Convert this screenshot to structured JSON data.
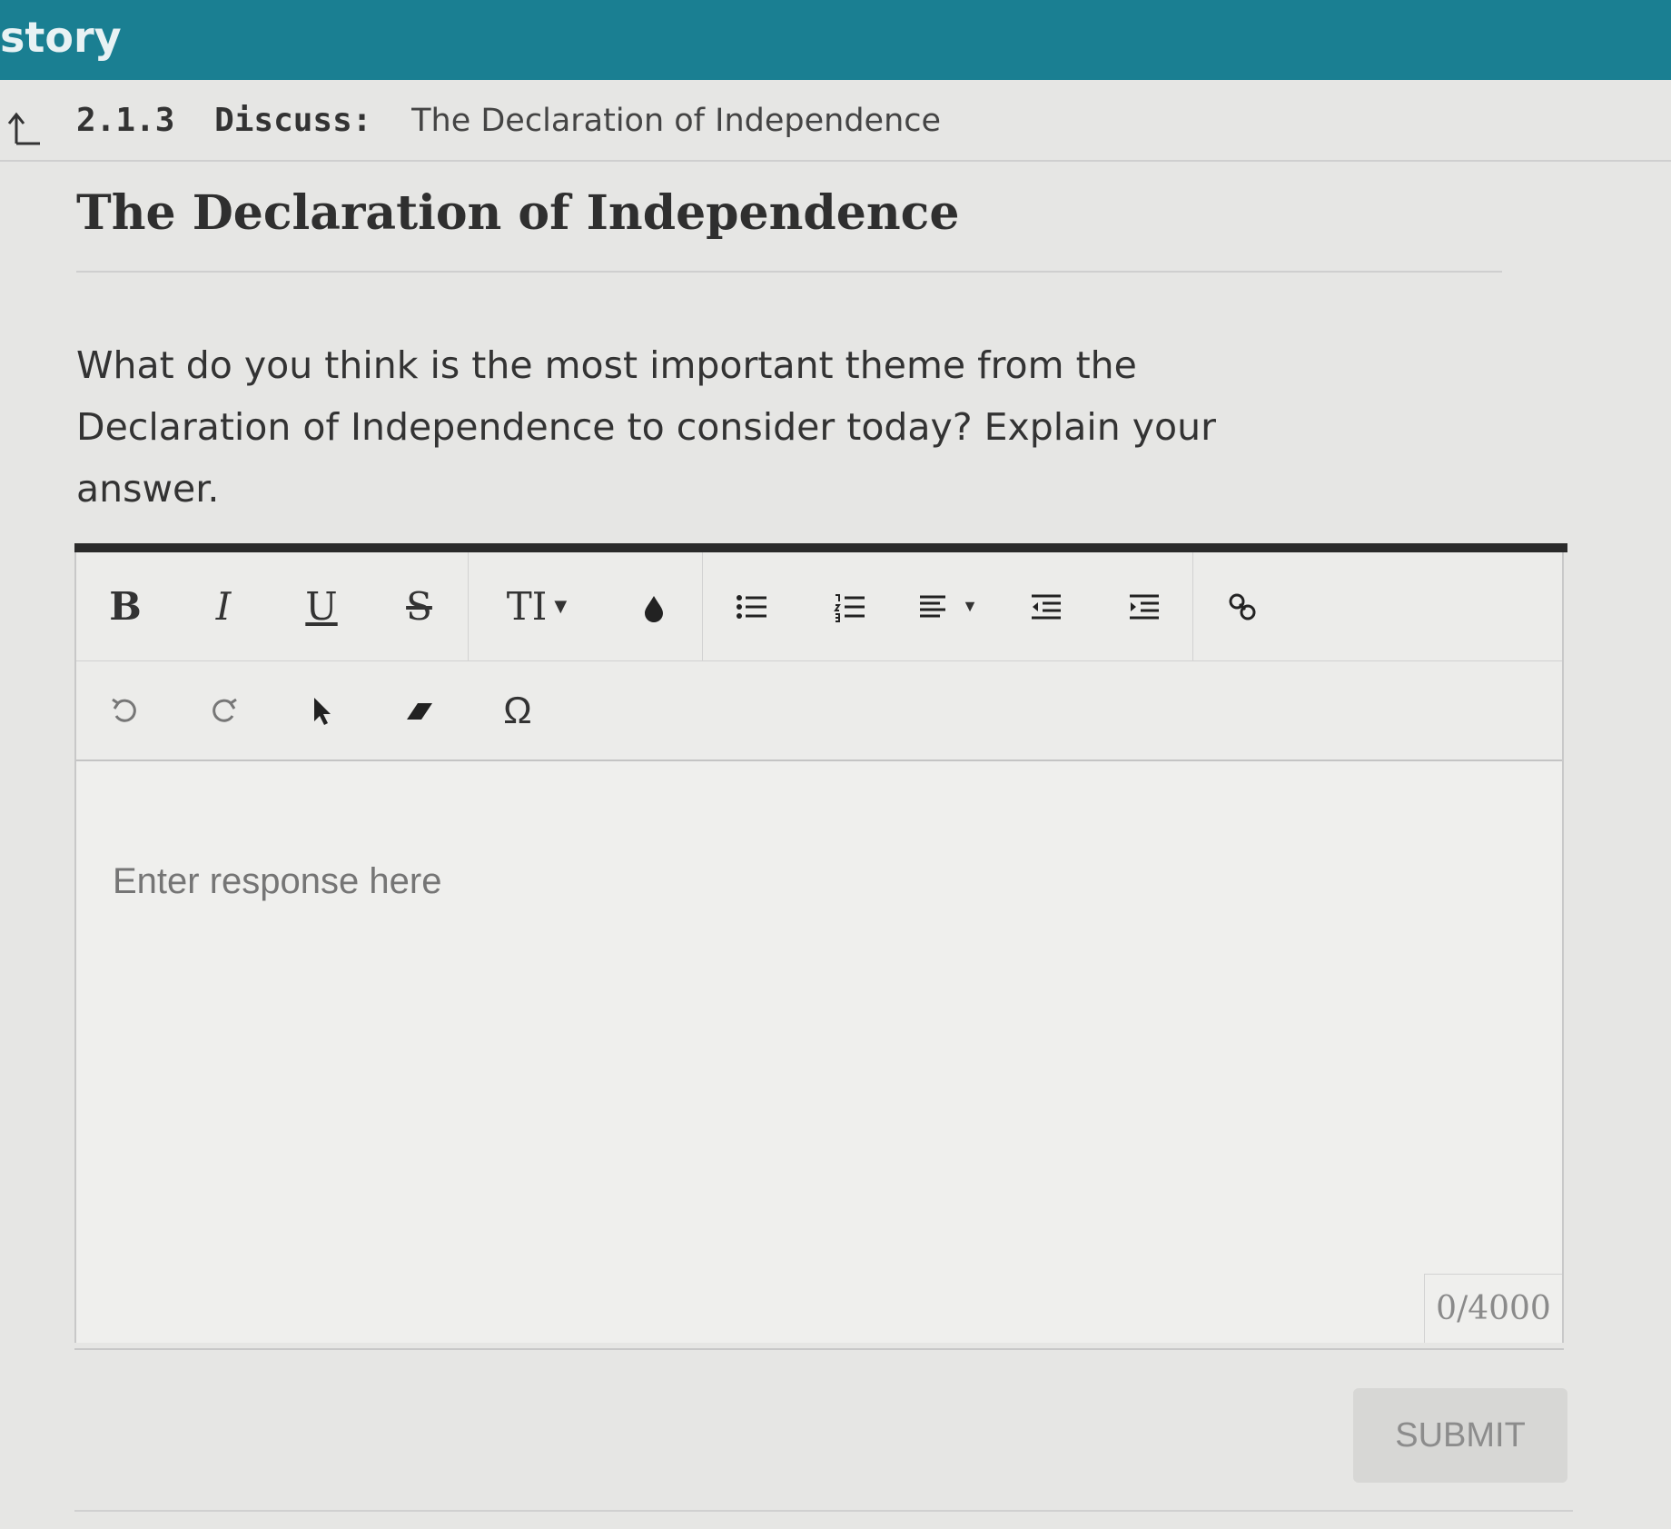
{
  "app": {
    "title": "story"
  },
  "breadcrumb": {
    "number": "2.1.3",
    "kind": "Discuss:",
    "name": "The Declaration of Independence"
  },
  "page": {
    "title": "The Declaration of Independence",
    "prompt": "What do you think is the most important theme from the Declaration of Independence to consider today? Explain your answer."
  },
  "toolbar": {
    "bold": "B",
    "italic": "I",
    "underline": "U",
    "strike": "S",
    "font_size": "TI",
    "special_char": "Ω",
    "icons": [
      "bold-icon",
      "italic-icon",
      "underline-icon",
      "strikethrough-icon",
      "font-size-icon",
      "text-color-icon",
      "bulleted-list-icon",
      "numbered-list-icon",
      "align-icon",
      "outdent-icon",
      "indent-icon",
      "link-icon",
      "undo-icon",
      "redo-icon",
      "select-icon",
      "eraser-icon",
      "special-character-icon"
    ]
  },
  "editor": {
    "placeholder": "Enter response here",
    "char_count": "0/4000"
  },
  "actions": {
    "submit": "SUBMIT"
  }
}
